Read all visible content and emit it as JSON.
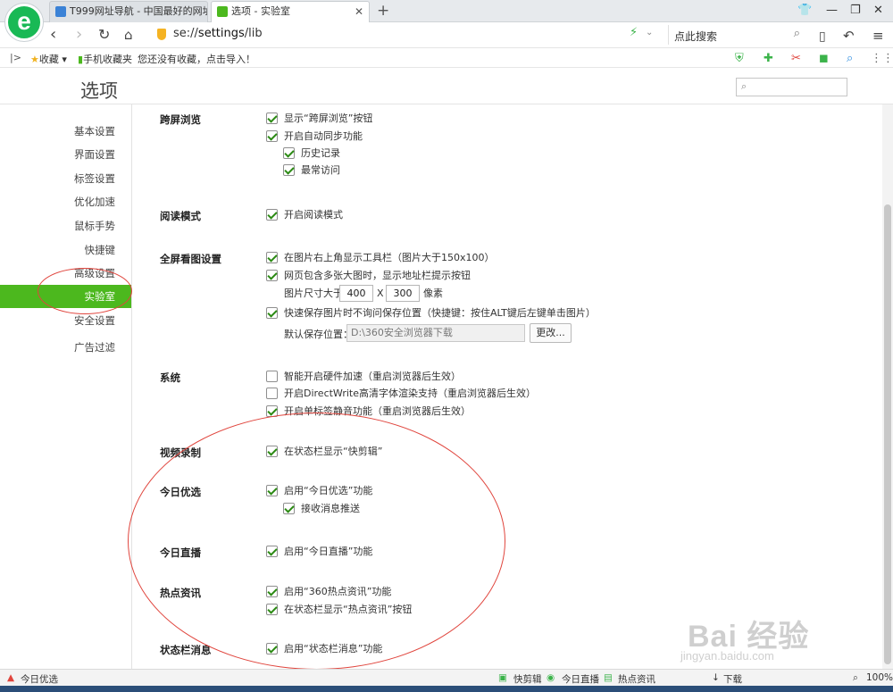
{
  "tabs": [
    {
      "title": "T999网址导航 - 中国最好的网址",
      "icon_color": "#3b82d6"
    },
    {
      "title": "选项 - 实验室",
      "icon_color": "#4cb81e"
    }
  ],
  "window_controls": [
    "shirt-icon",
    "minimize-icon",
    "restore-icon",
    "close-icon"
  ],
  "address": {
    "prefix": "se://",
    "path": "settings",
    "suffix": "/lib"
  },
  "search": {
    "placeholder": "点此搜索"
  },
  "bookmarks": {
    "collect_label": "收藏",
    "mobile_label": "手机收藏夹",
    "import_hint": "您还没有收藏，点击导入！"
  },
  "options": {
    "title": "选项"
  },
  "sidebar": {
    "items": [
      "基本设置",
      "界面设置",
      "标签设置",
      "优化加速",
      "鼠标手势",
      "快捷键",
      "高级设置",
      "实验室",
      "安全设置",
      "广告过滤"
    ],
    "active_index": 7
  },
  "sections": {
    "cross_screen": {
      "title": "跨屏浏览",
      "options": [
        {
          "label": "显示“跨屏浏览”按钮",
          "checked": true
        },
        {
          "label": "开启自动同步功能",
          "checked": true
        },
        {
          "label": "历史记录",
          "checked": true
        },
        {
          "label": "最常访问",
          "checked": true
        }
      ]
    },
    "reading": {
      "title": "阅读模式",
      "options": [
        {
          "label": "开启阅读模式",
          "checked": true
        }
      ]
    },
    "fullscreen_image": {
      "title": "全屏看图设置",
      "options": [
        {
          "label": "在图片右上角显示工具栏（图片大于150x100）",
          "checked": true
        },
        {
          "label": "网页包含多张大图时，显示地址栏提示按钮",
          "checked": true
        },
        {
          "label": "快速保存图片时不询问保存位置（快捷键：按住ALT键后左键单击图片）",
          "checked": true
        }
      ],
      "size_prefix": "图片尺寸大于",
      "width": "400",
      "size_sep": "X",
      "height": "300",
      "size_unit": "像素",
      "save_label": "默认保存位置：",
      "save_path": "D:\\360安全浏览器下载",
      "change_button": "更改..."
    },
    "system": {
      "title": "系统",
      "options": [
        {
          "label": "智能开启硬件加速（重启浏览器后生效）",
          "checked": false
        },
        {
          "label": "开启DirectWrite高清字体渲染支持（重启浏览器后生效）",
          "checked": false
        },
        {
          "label": "开启单标签静音功能（重启浏览器后生效）",
          "checked": true
        }
      ]
    },
    "video": {
      "title": "视频录制",
      "options": [
        {
          "label": "在状态栏显示“快剪辑”",
          "checked": true
        }
      ]
    },
    "today_pick": {
      "title": "今日优选",
      "options": [
        {
          "label": "启用“今日优选”功能",
          "checked": true
        },
        {
          "label": "接收消息推送",
          "checked": true
        }
      ]
    },
    "today_live": {
      "title": "今日直播",
      "options": [
        {
          "label": "启用“今日直播”功能",
          "checked": true
        }
      ]
    },
    "hot_news": {
      "title": "热点资讯",
      "options": [
        {
          "label": "启用“360热点资讯”功能",
          "checked": true
        },
        {
          "label": "在状态栏显示“热点资讯”按钮",
          "checked": true
        }
      ]
    },
    "status_msg": {
      "title": "状态栏消息",
      "options": [
        {
          "label": "启用“状态栏消息”功能",
          "checked": true
        }
      ]
    }
  },
  "statusbar": {
    "left": "今日优选",
    "items": [
      "快剪辑",
      "今日直播",
      "热点资讯",
      "下载"
    ],
    "zoom": "100%"
  },
  "watermark": {
    "text": "Bai 经验",
    "url": "jingyan.baidu.com"
  },
  "colors": {
    "accent": "#4cb81e",
    "annotation": "#e0453d",
    "brand": "#19b955"
  }
}
